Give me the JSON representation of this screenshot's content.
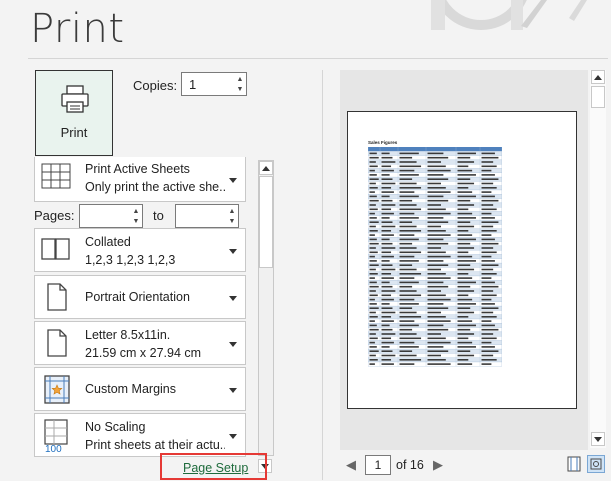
{
  "title": "Print",
  "print_button": {
    "label": "Print",
    "icon": "printer-icon"
  },
  "copies": {
    "label": "Copies:",
    "value": "1"
  },
  "settings": [
    {
      "line1": "Print Active Sheets",
      "line2": "Only print the active she...",
      "icon": "sheet-grid-icon"
    },
    {
      "line1": "Collated",
      "line2": "1,2,3    1,2,3    1,2,3",
      "icon": "collated-icon"
    },
    {
      "line1": "Portrait Orientation",
      "line2": "",
      "icon": "portrait-page-icon"
    },
    {
      "line1": "Letter 8.5x11in.",
      "line2": "21.59 cm x 27.94 cm",
      "icon": "paper-size-icon"
    },
    {
      "line1": "Custom Margins",
      "line2": "",
      "icon": "custom-margins-icon"
    },
    {
      "line1": "No Scaling",
      "line2": "Print sheets at their actu...",
      "icon": "no-scaling-icon",
      "icon_text": "100"
    }
  ],
  "pages": {
    "label": "Pages:",
    "to_label": "to",
    "from": "",
    "to": ""
  },
  "page_setup_link": "Page Setup",
  "preview": {
    "sheet_title": "Sales Figures",
    "header_color": "#4f81bd",
    "row_stripe_color": "#dce6f1",
    "row_count": 50
  },
  "navigation": {
    "current_page": "1",
    "of_label": "of 16"
  },
  "accent_color": "#1e6b3c",
  "highlight_color": "#e53935"
}
